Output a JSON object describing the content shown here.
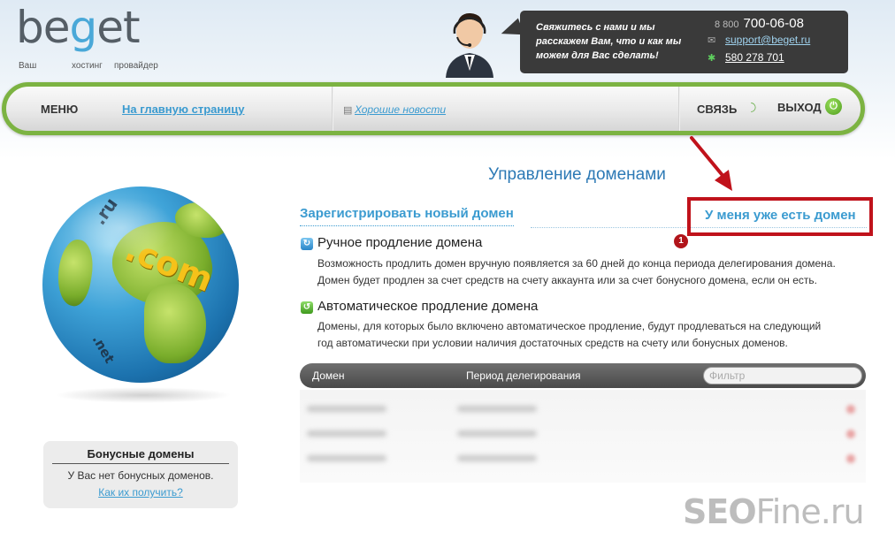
{
  "logo": {
    "word_start": "be",
    "word_accent": "g",
    "word_end": "et",
    "tagline": [
      "Ваш",
      "хостинг",
      "провайдер"
    ]
  },
  "contact": {
    "message": "Свяжитесь с нами и мы расскажем Вам, что и как мы можем для Вас сделать!",
    "phone_prefix": "8 800",
    "phone_number": "700-06-08",
    "email": "support@beget.ru",
    "icq": "580 278 701"
  },
  "nav": {
    "menu_label": "МЕНЮ",
    "home_link": "На главную страницу",
    "news_link": "Хорошие новости",
    "contact_label": "СВЯЗЬ",
    "exit_label": "ВЫХОД"
  },
  "globe": {
    "ru": ".ru",
    "com": ".com",
    "net": ".net"
  },
  "bonus": {
    "title": "Бонусные домены",
    "empty_text": "У Вас нет бонусных доменов.",
    "how_link": "Как их получить?"
  },
  "main": {
    "page_title": "Управление доменами",
    "register_link": "Зарегистрировать новый домен",
    "have_domain_link": "У меня уже есть домен",
    "annotation_number": "1",
    "features": [
      {
        "icon": "refresh-icon",
        "title": "Ручное продление домена",
        "desc_line1": "Возможность продлить домен вручную появляется за 60 дней до конца периода делегирования домена.",
        "desc_line2": "Домен будет продлен за счет средств на счету аккаунта или за счет бонусного домена, если он есть."
      },
      {
        "icon": "auto-renew-icon",
        "title": "Автоматическое продление домена",
        "desc_line1": "Домены, для которых было включено автоматическое продление, будут продлеваться на следующий",
        "desc_line2": "год автоматически при условии наличия достаточных средств на счету или бонусных доменов."
      }
    ],
    "table": {
      "col_domain": "Домен",
      "col_period": "Период делегирования",
      "filter_placeholder": "Фильтр"
    }
  },
  "watermark": {
    "bold": "SEO",
    "light": "Fine.ru"
  },
  "colors": {
    "nav_border": "#7cb342",
    "link_blue": "#3b9bd0",
    "title_blue": "#2c79b5",
    "annotation_red": "#c0121b",
    "contact_bg": "#3a3a3a"
  }
}
